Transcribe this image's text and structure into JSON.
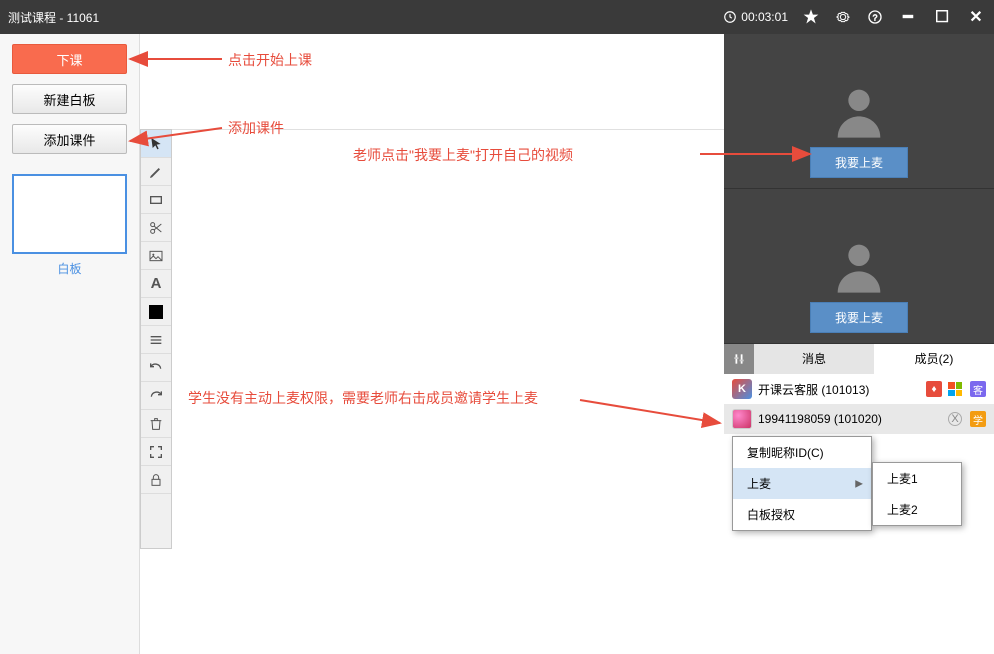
{
  "titlebar": {
    "title": "测试课程 - 11061",
    "time": "00:03:01"
  },
  "left": {
    "end_class": "下课",
    "new_board": "新建白板",
    "add_courseware": "添加课件",
    "thumb_label": "白板"
  },
  "right": {
    "mic_button": "我要上麦",
    "tabs": {
      "msg": "消息",
      "members": "成员(2)"
    }
  },
  "members": [
    {
      "name": "开课云客服",
      "id": "101013"
    },
    {
      "name": "19941198059",
      "id": "101020"
    }
  ],
  "context_menu": {
    "copy_id": "复制昵称ID(C)",
    "on_mic": "上麦",
    "whiteboard_auth": "白板授权"
  },
  "submenu": {
    "mic1": "上麦1",
    "mic2": "上麦2"
  },
  "annotations": {
    "a1": "点击开始上课",
    "a2": "添加课件",
    "a3": "老师点击\"我要上麦\"打开自己的视频",
    "a4": "学生没有主动上麦权限，需要老师右击成员邀请学生上麦"
  }
}
